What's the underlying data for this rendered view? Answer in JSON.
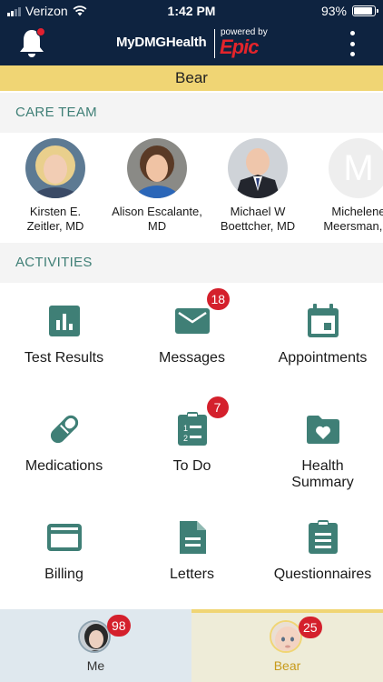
{
  "status_bar": {
    "carrier": "Verizon",
    "time": "1:42 PM",
    "battery": "93%",
    "battery_level": 0.93
  },
  "header": {
    "brand": "MyDMGHealth",
    "powered_by": "powered by",
    "epic": "Epic"
  },
  "patient": {
    "name": "Bear"
  },
  "care_team": {
    "title": "CARE TEAM",
    "members": [
      {
        "line1": "Kirsten E.",
        "line2": "Zeitler, MD"
      },
      {
        "line1": "Alison Escalante,",
        "line2": "MD"
      },
      {
        "line1": "Michael W",
        "line2": "Boettcher, MD"
      },
      {
        "line1": "Michelene",
        "line2": "Meersman, P",
        "initial": "M"
      }
    ]
  },
  "activities": {
    "title": "ACTIVITIES",
    "items": [
      {
        "label": "Test Results",
        "icon": "chart-icon"
      },
      {
        "label": "Messages",
        "icon": "envelope-icon",
        "badge": "18"
      },
      {
        "label": "Appointments",
        "icon": "calendar-icon"
      },
      {
        "label": "Medications",
        "icon": "pill-icon"
      },
      {
        "label": "To Do",
        "icon": "checklist-icon",
        "badge": "7"
      },
      {
        "label_line1": "Health",
        "label_line2": "Summary",
        "icon": "folder-heart-icon"
      },
      {
        "label": "Billing",
        "icon": "credit-card-icon"
      },
      {
        "label": "Letters",
        "icon": "document-icon"
      },
      {
        "label": "Questionnaires",
        "icon": "clipboard-icon"
      }
    ]
  },
  "tabs": [
    {
      "label": "Me",
      "badge": "98"
    },
    {
      "label": "Bear",
      "badge": "25"
    }
  ],
  "colors": {
    "navy": "#0e2340",
    "teal": "#3f7f76",
    "banner": "#f0d574",
    "badge": "#d4202c"
  }
}
